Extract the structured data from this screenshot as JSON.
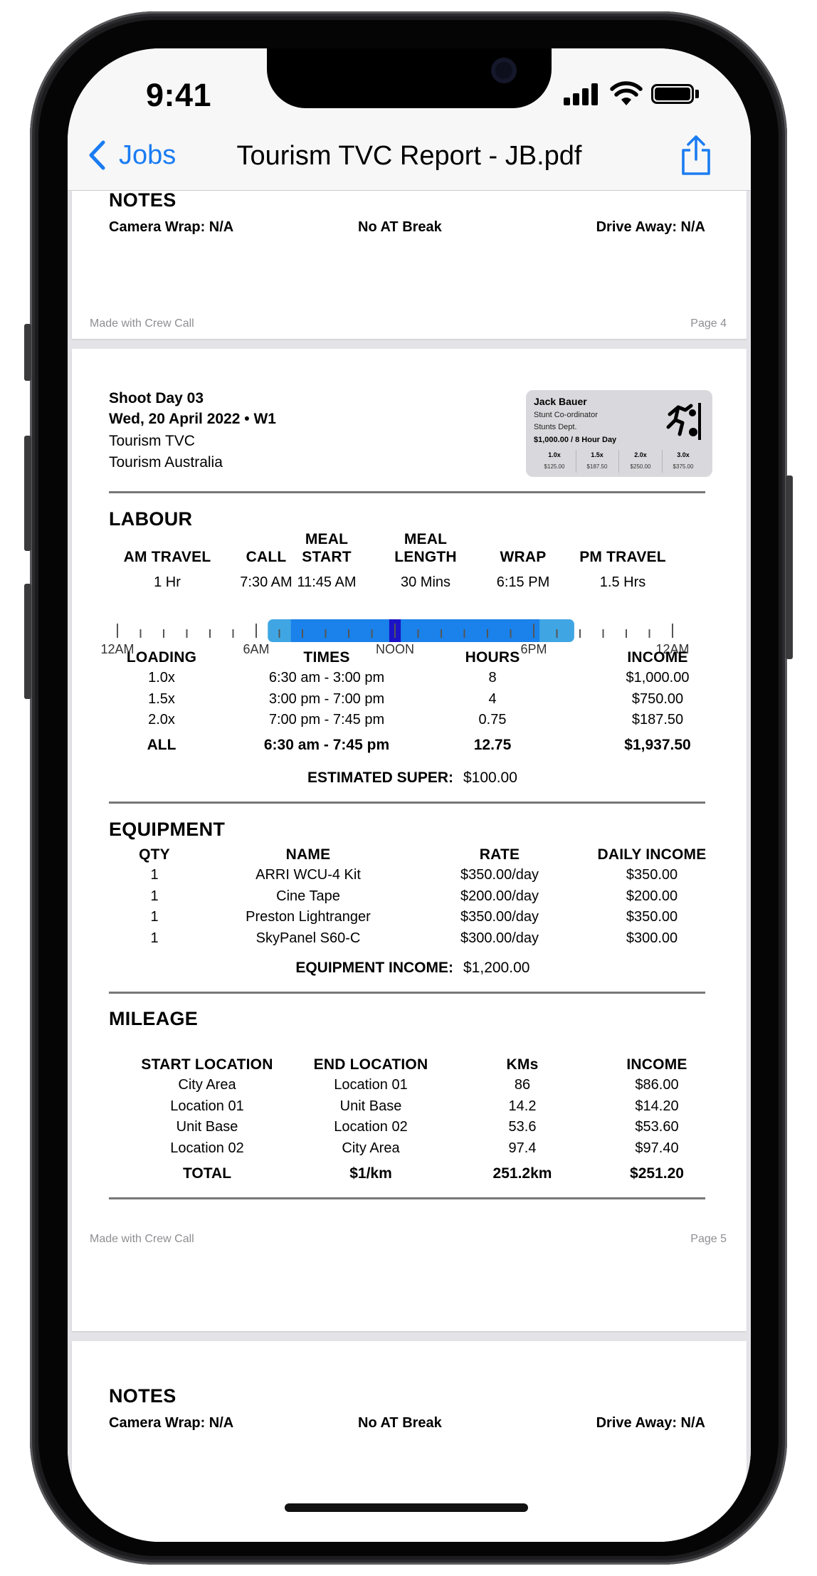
{
  "status_bar": {
    "time": "9:41"
  },
  "nav": {
    "back_label": "Jobs",
    "title": "Tourism TVC Report - JB.pdf"
  },
  "colors": {
    "accent": "#1a7cf2",
    "timeline_work": "#1a82ea",
    "timeline_travel": "#3fa6e3",
    "timeline_meal": "#1b14c7"
  },
  "page4": {
    "notes_title": "NOTES",
    "camera_wrap": "Camera Wrap: N/A",
    "break": "No AT Break",
    "drive_away": "Drive Away: N/A",
    "footer_left": "Made with Crew Call",
    "footer_right": "Page 4"
  },
  "page5": {
    "shoot_day": "Shoot Day 03",
    "date": "Wed, 20 April 2022 • W1",
    "project": "Tourism TVC",
    "client": "Tourism Australia",
    "crew_card": {
      "name": "Jack Bauer",
      "role": "Stunt Co-ordinator",
      "dept": "Stunts Dept.",
      "rate": "$1,000.00 / 8 Hour Day",
      "icon": "stunt-person-icon",
      "multipliers": [
        {
          "label": "1.0x",
          "amount": "$125.00"
        },
        {
          "label": "1.5x",
          "amount": "$187.50"
        },
        {
          "label": "2.0x",
          "amount": "$250.00"
        },
        {
          "label": "3.0x",
          "amount": "$375.00"
        }
      ]
    },
    "labour": {
      "title": "LABOUR",
      "headers": {
        "am_travel": "AM TRAVEL",
        "call": "CALL",
        "meal_start_1": "MEAL",
        "meal_start_2": "START",
        "meal_length_1": "MEAL",
        "meal_length_2": "LENGTH",
        "wrap": "WRAP",
        "pm_travel": "PM TRAVEL"
      },
      "values": {
        "am_travel": "1 Hr",
        "call": "7:30 AM",
        "meal_start": "11:45 AM",
        "meal_length": "30 Mins",
        "wrap": "6:15 PM",
        "pm_travel": "1.5 Hrs"
      },
      "timeline": {
        "labels": [
          "12AM",
          "6AM",
          "NOON",
          "6PM",
          "12AM"
        ],
        "travel_start_hour": 6.5,
        "work_start_hour": 7.5,
        "meal_start_hour": 11.75,
        "meal_end_hour": 12.25,
        "work_end_hour": 18.25,
        "travel_end_hour": 19.75
      },
      "table_headers": {
        "loading": "LOADING",
        "times": "TIMES",
        "hours": "HOURS",
        "income": "INCOME"
      },
      "rows": [
        {
          "loading": "1.0x",
          "times": "6:30 am - 3:00 pm",
          "hours": "8",
          "income": "$1,000.00"
        },
        {
          "loading": "1.5x",
          "times": "3:00 pm - 7:00 pm",
          "hours": "4",
          "income": "$750.00"
        },
        {
          "loading": "2.0x",
          "times": "7:00 pm - 7:45 pm",
          "hours": "0.75",
          "income": "$187.50"
        }
      ],
      "total": {
        "loading": "ALL",
        "times": "6:30 am - 7:45 pm",
        "hours": "12.75",
        "income": "$1,937.50"
      },
      "super_label": "ESTIMATED SUPER:",
      "super_value": "$100.00"
    },
    "equipment": {
      "title": "EQUIPMENT",
      "headers": {
        "qty": "QTY",
        "name": "NAME",
        "rate": "RATE",
        "daily": "DAILY INCOME"
      },
      "rows": [
        {
          "qty": "1",
          "name": "ARRI WCU-4 Kit",
          "rate": "$350.00/day",
          "daily": "$350.00"
        },
        {
          "qty": "1",
          "name": "Cine Tape",
          "rate": "$200.00/day",
          "daily": "$200.00"
        },
        {
          "qty": "1",
          "name": "Preston Lightranger",
          "rate": "$350.00/day",
          "daily": "$350.00"
        },
        {
          "qty": "1",
          "name": "SkyPanel S60-C",
          "rate": "$300.00/day",
          "daily": "$300.00"
        }
      ],
      "income_label": "EQUIPMENT INCOME:",
      "income_value": "$1,200.00"
    },
    "mileage": {
      "title": "MILEAGE",
      "headers": {
        "start": "START LOCATION",
        "end": "END LOCATION",
        "kms": "KMs",
        "income": "INCOME"
      },
      "rows": [
        {
          "start": "City Area",
          "end": "Location 01",
          "kms": "86",
          "income": "$86.00"
        },
        {
          "start": "Location 01",
          "end": "Unit Base",
          "kms": "14.2",
          "income": "$14.20"
        },
        {
          "start": "Unit Base",
          "end": "Location 02",
          "kms": "53.6",
          "income": "$53.60"
        },
        {
          "start": "Location 02",
          "end": "City Area",
          "kms": "97.4",
          "income": "$97.40"
        }
      ],
      "total": {
        "start": "TOTAL",
        "end": "$1/km",
        "kms": "251.2km",
        "income": "$251.20"
      }
    },
    "footer_left": "Made with Crew Call",
    "footer_right": "Page 5"
  },
  "page6": {
    "notes_title": "NOTES",
    "camera_wrap": "Camera Wrap: N/A",
    "break": "No AT Break",
    "drive_away": "Drive Away: N/A"
  }
}
